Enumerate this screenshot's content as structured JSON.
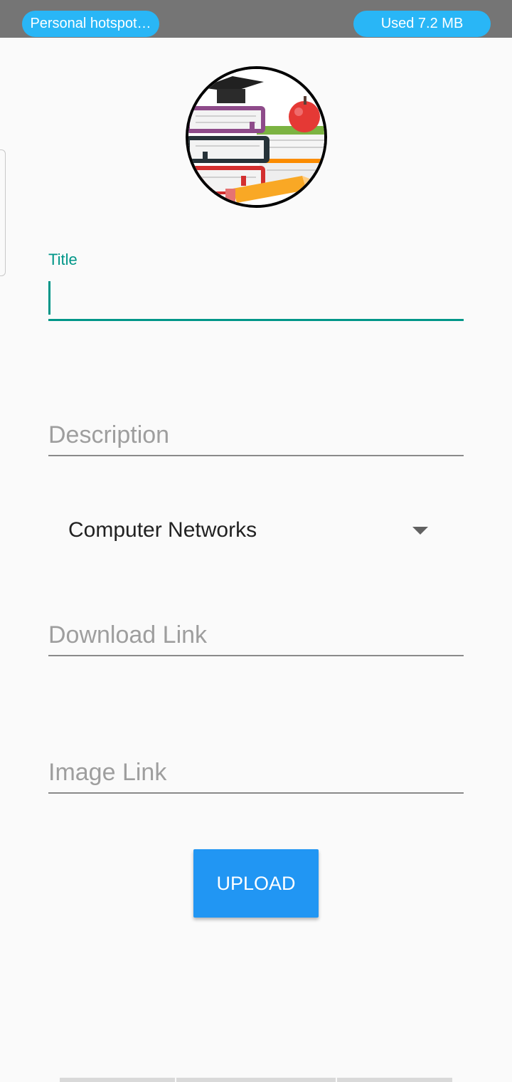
{
  "status_bar": {
    "hotspot_label": "Personal hotspot…",
    "usage_label": "Used  7.2 MB"
  },
  "header": {
    "image": "books-apple-graduation-cap-illustration"
  },
  "form": {
    "title_field": {
      "label": "Title",
      "value": ""
    },
    "description_field": {
      "placeholder": "Description",
      "value": ""
    },
    "category_dropdown": {
      "selected": "Computer Networks"
    },
    "download_link_field": {
      "placeholder": "Download Link",
      "value": ""
    },
    "image_link_field": {
      "placeholder": "Image Link",
      "value": ""
    },
    "upload_button": {
      "label": "UPLOAD"
    }
  },
  "colors": {
    "accent": "#009688",
    "button": "#2196f3",
    "status_pill": "#29b6f6"
  }
}
